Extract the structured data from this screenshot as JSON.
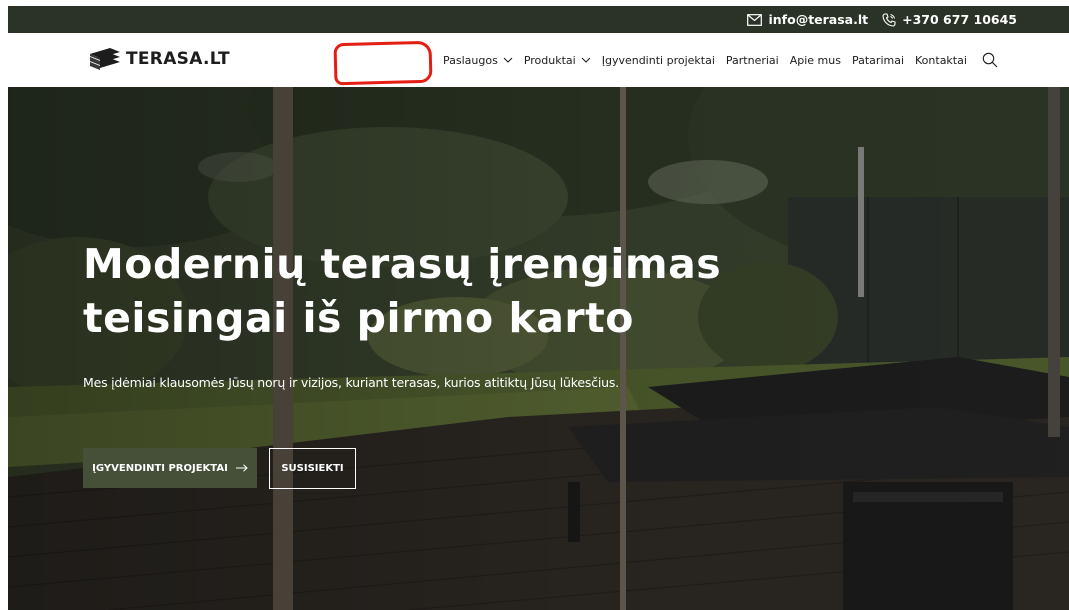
{
  "topbar": {
    "email": "info@terasa.lt",
    "phone": "+370 677 10645",
    "email_icon": "mail-icon",
    "phone_icon": "phone-icon"
  },
  "header": {
    "logo_text": "TERASA.LT",
    "logo_icon": "stacked-boards-logo-icon",
    "nav": [
      {
        "label": "Paslaugos",
        "has_dropdown": true
      },
      {
        "label": "Produktai",
        "has_dropdown": true
      },
      {
        "label": "Įgyvendinti projektai",
        "has_dropdown": false
      },
      {
        "label": "Partneriai",
        "has_dropdown": false
      },
      {
        "label": "Apie mus",
        "has_dropdown": false
      },
      {
        "label": "Patarimai",
        "has_dropdown": false
      },
      {
        "label": "Kontaktai",
        "has_dropdown": false
      }
    ],
    "search_icon": "search-icon"
  },
  "hero": {
    "title_line1": "Modernių terasų įrengimas",
    "title_line2": "teisingai iš pirmo karto",
    "subtitle": "Mes įdėmiai klausomės Jūsų norų ir vizijos, kuriant terasas, kurios atitiktų Jūsų lūkesčius.",
    "primary_button": "ĮGYVENDINTI PROJEKTAI",
    "secondary_button": "SUSISIEKTI"
  },
  "colors": {
    "topbar_bg": "#2b3326",
    "primary_button_bg": "#465038",
    "annotation_red": "#e41e12"
  }
}
